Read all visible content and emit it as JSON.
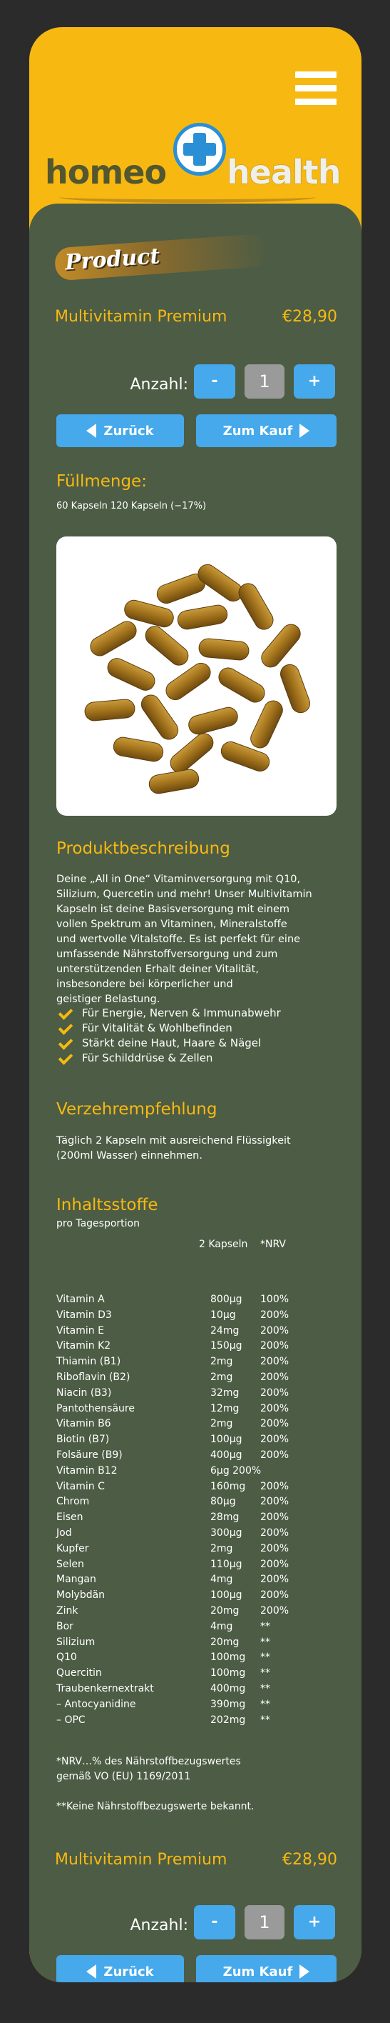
{
  "header": {
    "menu_icon": "hamburger-menu-icon",
    "logo": {
      "word1": "homeo",
      "word2": "health",
      "cross_color": "#2b8fd6"
    }
  },
  "colors": {
    "accent": "#f7b911",
    "panel": "#4d5c44",
    "button": "#45a9ec",
    "background": "#2b2b2b"
  },
  "badge": {
    "label": "Product"
  },
  "product": {
    "name": "Multivitamin Premium",
    "price": "€28,90"
  },
  "quantity": {
    "label": "Anzahl:",
    "minus": "-",
    "value": "1",
    "plus": "+"
  },
  "nav": {
    "back": "Zurück",
    "buy": "Zum Kauf"
  },
  "fill": {
    "heading": "Füllmenge:",
    "options": "60 Kapseln 120 Kapseln (−17%)"
  },
  "description": {
    "heading": "Produktbeschreibung",
    "lines": [
      "Deine „All in One“ Vitaminversorgung mit Q10,",
      "Silizium, Quercetin und mehr! Unser Multivitamin",
      "Kapseln ist deine Basisversorgung mit einem",
      "vollen Spektrum an Vitaminen, Mineralstoffe",
      "und wertvolle Vitalstoffe. Es ist perfekt für eine",
      "umfassende Nährstoffversorgung und zum",
      "unterstützenden Erhalt deiner Vitalität,",
      "insbesondere bei körperlicher und",
      "geistiger Belastung."
    ],
    "benefits": [
      "Für Energie, Nerven & Immunabwehr",
      "Für Vitalität & Wohlbefinden",
      "Stärkt deine Haut, Haare & Nägel",
      "Für Schilddrüse & Zellen"
    ]
  },
  "recommendation": {
    "heading": "Verzehrempfehlung",
    "lines": [
      "Täglich 2 Kapseln mit ausreichend Flüssigkeit",
      "(200ml Wasser) einnehmen."
    ]
  },
  "ingredients": {
    "heading": "Inhaltsstoffe",
    "subheading": "pro Tagesportion",
    "col_amount": "2 Kapseln",
    "col_nrv": "*NRV",
    "rows": [
      [
        "Vitamin A",
        "800µg",
        "100%"
      ],
      [
        "Vitamin D3",
        "10µg",
        "200%"
      ],
      [
        "Vitamin E",
        "24mg",
        "200%"
      ],
      [
        "Vitamin K2",
        "150µg",
        "200%"
      ],
      [
        "Thiamin (B1)",
        "2mg",
        "200%"
      ],
      [
        "Riboflavin (B2)",
        "2mg",
        "200%"
      ],
      [
        "Niacin (B3)",
        "32mg",
        "200%"
      ],
      [
        "Pantothensäure",
        "12mg",
        "200%"
      ],
      [
        "Vitamin B6",
        "2mg",
        "200%"
      ],
      [
        "Biotin (B7)",
        "100µg",
        "200%"
      ],
      [
        "Folsäure (B9)",
        "400µg",
        "200%"
      ],
      [
        "Vitamin B12",
        "6µg 200%",
        ""
      ],
      [
        "Vitamin C",
        "160mg",
        "200%"
      ],
      [
        "Chrom",
        "80µg",
        "200%"
      ],
      [
        "Eisen",
        "28mg",
        "200%"
      ],
      [
        "Jod",
        "300µg",
        "200%"
      ],
      [
        "Kupfer",
        "2mg",
        "200%"
      ],
      [
        "Selen",
        "110µg",
        "200%"
      ],
      [
        "Mangan",
        "4mg",
        "200%"
      ],
      [
        "Molybdän",
        "100µg",
        "200%"
      ],
      [
        "Zink",
        "20mg",
        "200%"
      ],
      [
        "Bor",
        "4mg",
        "**"
      ],
      [
        "Silizium",
        "20mg",
        "**"
      ],
      [
        "Q10",
        "100mg",
        "**"
      ],
      [
        "Quercitin",
        "100mg",
        "**"
      ],
      [
        "Traubenkernextrakt",
        "400mg",
        "**"
      ],
      [
        "  – Antocyanidine",
        "390mg",
        "**"
      ],
      [
        "  – OPC",
        "202mg",
        "**"
      ]
    ],
    "footnote1_line1": "*NRV…% des Nährstoffbezugswertes",
    "footnote1_line2": "gemäß VO (EU) 1169/2011",
    "footnote2": "**Keine Nährstoffbezugswerte bekannt."
  }
}
